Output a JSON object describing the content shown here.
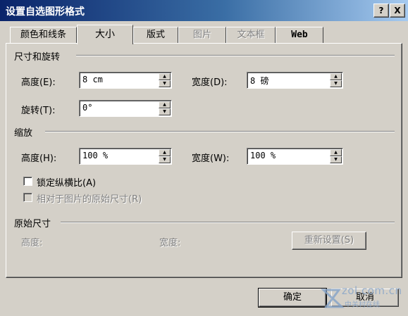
{
  "window": {
    "title": "设置自选图形格式",
    "help_label": "?",
    "close_label": "X"
  },
  "tabs": [
    {
      "label": "颜色和线条",
      "state": "normal"
    },
    {
      "label": "大小",
      "state": "active"
    },
    {
      "label": "版式",
      "state": "normal"
    },
    {
      "label": "图片",
      "state": "disabled"
    },
    {
      "label": "文本框",
      "state": "disabled"
    },
    {
      "label": "Web",
      "state": "normal"
    }
  ],
  "size_rotate": {
    "title": "尺寸和旋转",
    "height_label": "高度(E):",
    "height_value": "8 cm",
    "width_label": "宽度(D):",
    "width_value": "8 磅",
    "rotation_label": "旋转(T):",
    "rotation_value": "0°"
  },
  "scale": {
    "title": "缩放",
    "height_label": "高度(H):",
    "height_value": "100 %",
    "width_label": "宽度(W):",
    "width_value": "100 %",
    "lock_aspect_label": "锁定纵横比(A)",
    "lock_aspect_checked": false,
    "relative_label": "相对于图片的原始尺寸(R)",
    "relative_checked": false
  },
  "original_size": {
    "title": "原始尺寸",
    "height_label": "高度:",
    "width_label": "宽度:",
    "reset_label": "重新设置(S)"
  },
  "footer": {
    "ok_label": "确定",
    "cancel_label": "取消"
  },
  "watermark": {
    "site": "zol.com.cn",
    "sub": "中关村在线"
  },
  "colors": {
    "face": "#d4d0c8",
    "titlebar_start": "#0a246a",
    "titlebar_end": "#a6caf0"
  }
}
